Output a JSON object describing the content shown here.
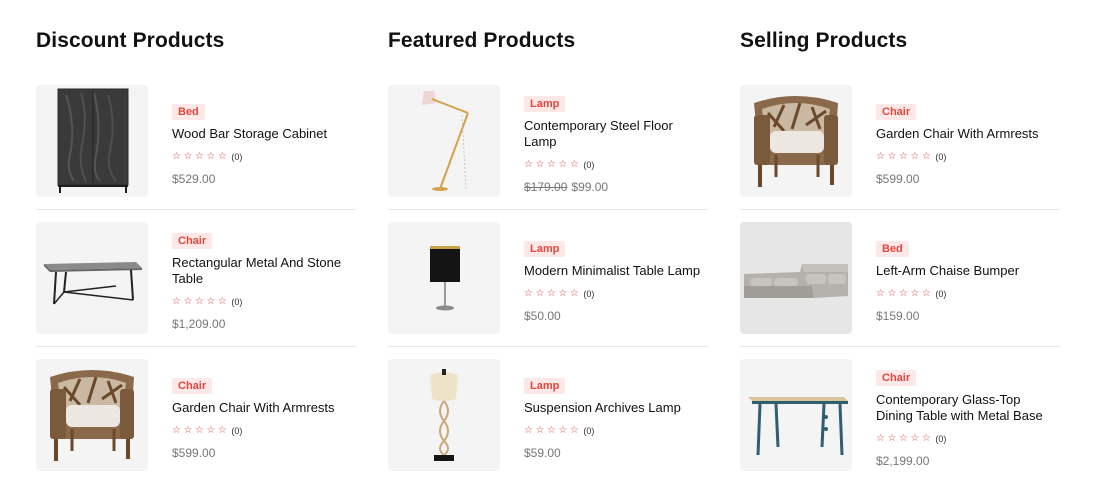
{
  "columns": [
    {
      "title": "Discount Products",
      "products": [
        {
          "category": "Bed",
          "name": "Wood Bar Storage Cabinet",
          "rating_count": "(0)",
          "old_price": "",
          "price": "$529.00",
          "image": "cabinet-image"
        },
        {
          "category": "Chair",
          "name": "Rectangular Metal And Stone Table",
          "rating_count": "(0)",
          "old_price": "",
          "price": "$1,209.00",
          "image": "table-image"
        },
        {
          "category": "Chair",
          "name": "Garden Chair With Armrests",
          "rating_count": "(0)",
          "old_price": "",
          "price": "$599.00",
          "image": "armchair-image"
        }
      ]
    },
    {
      "title": "Featured Products",
      "products": [
        {
          "category": "Lamp",
          "name": "Contemporary Steel Floor Lamp",
          "rating_count": "(0)",
          "old_price": "$179.00",
          "price": "$99.00",
          "image": "floor-lamp-image"
        },
        {
          "category": "Lamp",
          "name": "Modern Minimalist Table Lamp",
          "rating_count": "(0)",
          "old_price": "",
          "price": "$50.00",
          "image": "table-lamp-image"
        },
        {
          "category": "Lamp",
          "name": "Suspension Archives Lamp",
          "rating_count": "(0)",
          "old_price": "",
          "price": "$59.00",
          "image": "pendant-lamp-image"
        }
      ]
    },
    {
      "title": "Selling Products",
      "products": [
        {
          "category": "Chair",
          "name": "Garden Chair With Armrests",
          "rating_count": "(0)",
          "old_price": "",
          "price": "$599.00",
          "image": "armchair-image"
        },
        {
          "category": "Bed",
          "name": "Left-Arm Chaise Bumper",
          "rating_count": "(0)",
          "old_price": "",
          "price": "$159.00",
          "image": "sofa-image"
        },
        {
          "category": "Chair",
          "name": "Contemporary Glass-Top Dining Table with Metal Base",
          "rating_count": "(0)",
          "old_price": "",
          "price": "$2,199.00",
          "image": "dining-table-image"
        }
      ]
    }
  ],
  "rating": {
    "stars": 0,
    "max": 5,
    "star_icon": "star-outline-icon"
  },
  "colors": {
    "accent": "#e3463d",
    "badge_bg": "#fde8e8",
    "thumb_bg": "#f4f4f4",
    "divider": "#e8e8e8"
  }
}
